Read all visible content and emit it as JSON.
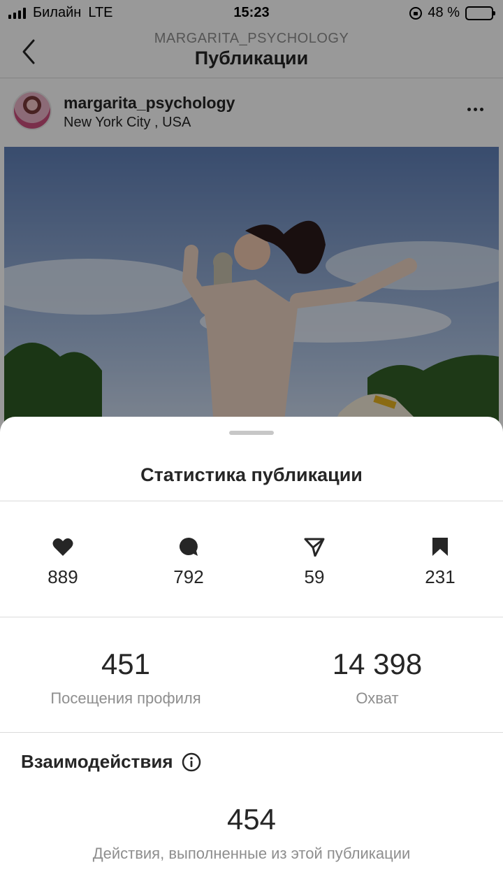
{
  "status_bar": {
    "carrier": "Билайн",
    "network": "LTE",
    "time": "15:23",
    "battery": "48 %",
    "battery_level": 0.48
  },
  "header": {
    "account_caps": "MARGARITA_PSYCHOLOGY",
    "title": "Публикации"
  },
  "post": {
    "username": "margarita_psychology",
    "location": "New York City , USA"
  },
  "sheet": {
    "title": "Статистика публикации",
    "counts": {
      "likes": "889",
      "comments": "792",
      "shares": "59",
      "saves": "231"
    },
    "profile_visits": {
      "value": "451",
      "label": "Посещения профиля"
    },
    "reach": {
      "value": "14 398",
      "label": "Охват"
    },
    "interactions": {
      "title": "Взаимодействия",
      "value": "454",
      "label": "Действия, выполненные из этой публикации"
    }
  },
  "colors": {
    "text": "#262626",
    "secondary": "#8e8e8e",
    "divider": "#dbdbdb",
    "overlay": "rgba(0,0,0,0.40)"
  }
}
